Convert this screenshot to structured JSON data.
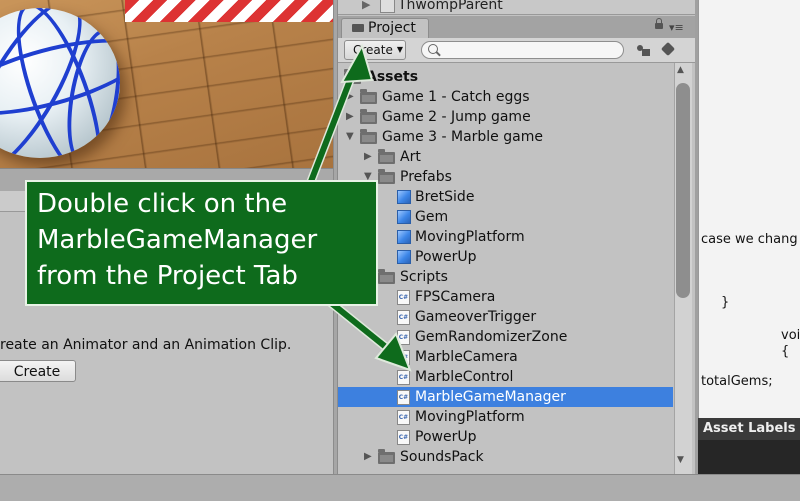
{
  "hierarchy": {
    "partial_item": "ThwompParent"
  },
  "project_panel": {
    "tab_label": "Project",
    "create_label": "Create",
    "search_placeholder": "",
    "items": [
      {
        "label": "Assets",
        "depth": 0,
        "kind": "folder",
        "expanded": true
      },
      {
        "label": "Game 1 - Catch eggs",
        "depth": 1,
        "kind": "folder",
        "expanded": false
      },
      {
        "label": "Game 2 - Jump game",
        "depth": 1,
        "kind": "folder",
        "expanded": false
      },
      {
        "label": "Game 3 - Marble game",
        "depth": 1,
        "kind": "folder",
        "expanded": true
      },
      {
        "label": "Art",
        "depth": 2,
        "kind": "folder",
        "expanded": false
      },
      {
        "label": "Prefabs",
        "depth": 2,
        "kind": "folder",
        "expanded": true
      },
      {
        "label": "BretSide",
        "depth": 3,
        "kind": "prefab"
      },
      {
        "label": "Gem",
        "depth": 3,
        "kind": "prefab"
      },
      {
        "label": "MovingPlatform",
        "depth": 3,
        "kind": "prefab"
      },
      {
        "label": "PowerUp",
        "depth": 3,
        "kind": "prefab"
      },
      {
        "label": "Scripts",
        "depth": 2,
        "kind": "folder",
        "expanded": true
      },
      {
        "label": "FPSCamera",
        "depth": 3,
        "kind": "script"
      },
      {
        "label": "GameoverTrigger",
        "depth": 3,
        "kind": "script"
      },
      {
        "label": "GemRandomizerZone",
        "depth": 3,
        "kind": "script"
      },
      {
        "label": "MarbleCamera",
        "depth": 3,
        "kind": "script"
      },
      {
        "label": "MarbleControl",
        "depth": 3,
        "kind": "script"
      },
      {
        "label": "MarbleGameManager",
        "depth": 3,
        "kind": "script",
        "selected": true
      },
      {
        "label": "MovingPlatform",
        "depth": 3,
        "kind": "script"
      },
      {
        "label": "PowerUp",
        "depth": 3,
        "kind": "script"
      },
      {
        "label": "SoundsPack",
        "depth": 2,
        "kind": "folder",
        "expanded": false
      }
    ]
  },
  "animation_panel": {
    "message": "reate an Animator and an Animation Clip.",
    "create_button": "Create"
  },
  "inspector": {
    "code_lines": [
      "case we chang",
      "}",
      "voi",
      "{",
      "totalGems;"
    ],
    "asset_labels": "Asset Labels"
  },
  "callout": {
    "lines": [
      "Double click on the",
      "MarbleGameManager",
      "from the Project Tab"
    ]
  },
  "colors": {
    "selection": "#3d80df",
    "callout_bg": "#0e6b1c",
    "arrow": "#0e6b1c"
  }
}
